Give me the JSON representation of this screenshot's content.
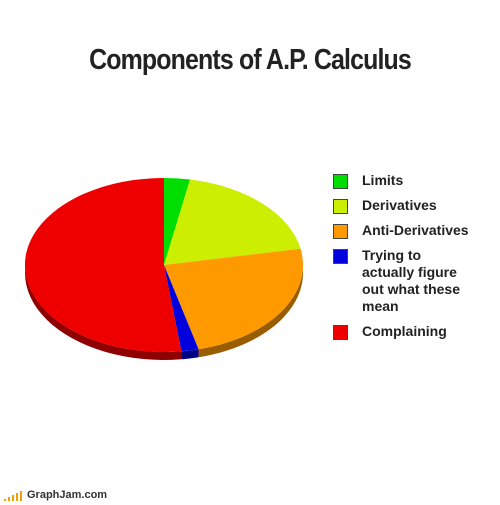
{
  "chart_data": {
    "type": "pie",
    "title": "Components of A.P. Calculus",
    "slices": [
      {
        "label": "Limits",
        "value": 3,
        "color": "#00dd00"
      },
      {
        "label": "Derivatives",
        "value": 19,
        "color": "#ccee00"
      },
      {
        "label": "Anti-Derivatives",
        "value": 24,
        "color": "#ff9900"
      },
      {
        "label": "Trying to actually figure out what these mean",
        "value": 2,
        "color": "#0000dd"
      },
      {
        "label": "Complaining",
        "value": 52,
        "color": "#ee0000"
      }
    ],
    "legend_placement": "right"
  },
  "footer": {
    "site": "GraphJam.com"
  }
}
